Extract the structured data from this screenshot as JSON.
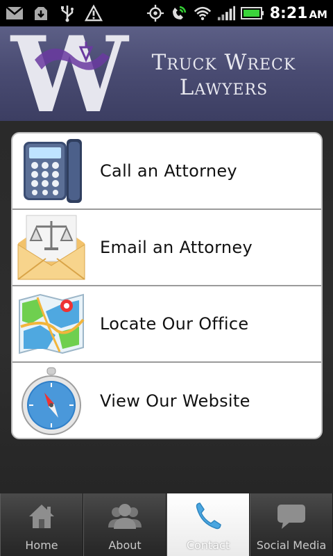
{
  "status_bar": {
    "time": "8:21",
    "ampm": "AM",
    "icons": [
      "gmail-icon",
      "download-icon",
      "usb-icon",
      "warning-icon",
      "gps-icon",
      "phone-signal-icon",
      "wifi-icon",
      "cell-signal-icon",
      "battery-icon"
    ]
  },
  "header": {
    "logo_letter": "W",
    "firm_line1": "Truck Wreck",
    "firm_line2": "Lawyers",
    "colors": {
      "background": "#4a4c73",
      "logo_accent": "#6a3aa0"
    }
  },
  "menu": {
    "items": [
      {
        "label": "Call an Attorney",
        "icon": "phone-icon"
      },
      {
        "label": "Email an Attorney",
        "icon": "email-scales-icon"
      },
      {
        "label": "Locate Our Office",
        "icon": "map-icon"
      },
      {
        "label": "View Our Website",
        "icon": "compass-icon"
      }
    ]
  },
  "tabs": [
    {
      "label": "Home",
      "icon": "home-icon",
      "active": false
    },
    {
      "label": "About",
      "icon": "people-icon",
      "active": false
    },
    {
      "label": "Contact",
      "icon": "phone-handset-icon",
      "active": true
    },
    {
      "label": "Social Media",
      "icon": "chat-bubble-icon",
      "active": false
    }
  ]
}
